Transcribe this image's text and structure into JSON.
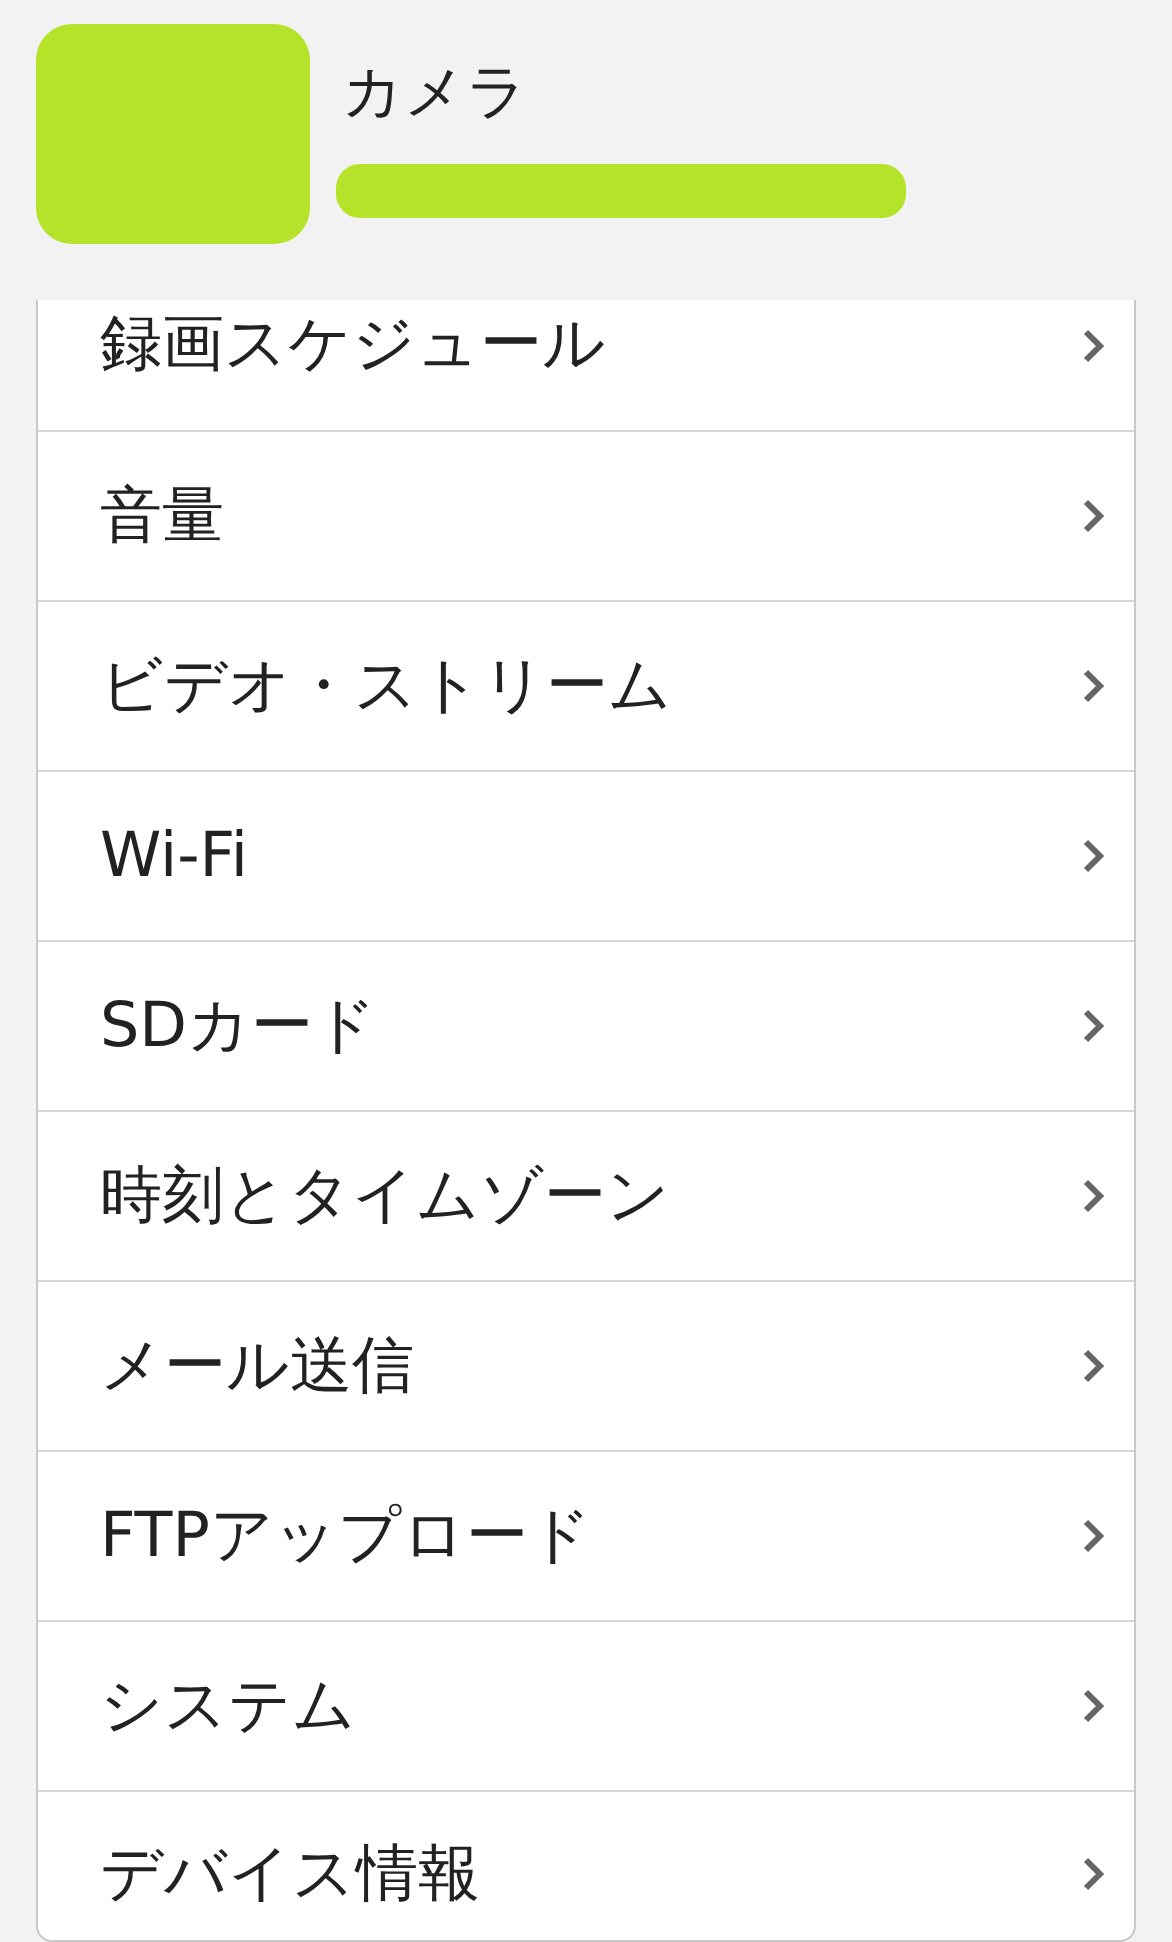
{
  "header": {
    "title": "カメラ"
  },
  "menu": [
    {
      "label": "録画スケジュール"
    },
    {
      "label": "音量"
    },
    {
      "label": "ビデオ・ストリーム"
    },
    {
      "label": "Wi-Fi"
    },
    {
      "label": "SDカード"
    },
    {
      "label": "時刻とタイムゾーン"
    },
    {
      "label": "メール送信"
    },
    {
      "label": "FTPアップロード"
    },
    {
      "label": "システム"
    },
    {
      "label": "デバイス情報"
    }
  ]
}
